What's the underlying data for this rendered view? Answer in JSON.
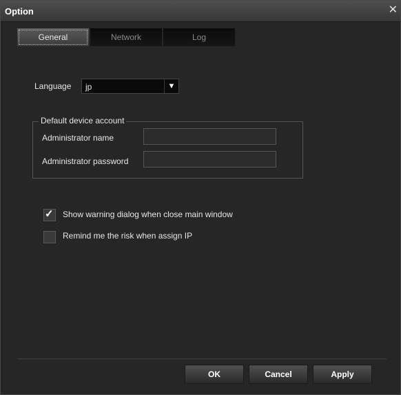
{
  "window": {
    "title": "Option",
    "close_symbol": "✕"
  },
  "tabs": [
    {
      "label": "General",
      "active": true
    },
    {
      "label": "Network",
      "active": false
    },
    {
      "label": "Log",
      "active": false
    }
  ],
  "general": {
    "language_label": "Language",
    "language_value": "jp",
    "account_group_title": "Default device account",
    "admin_name_label": "Administrator name",
    "admin_name_value": "",
    "admin_password_label": "Administrator password",
    "admin_password_value": "",
    "options": [
      {
        "label": "Show warning dialog when close main window",
        "checked": true
      },
      {
        "label": "Remind me the risk when assign IP",
        "checked": false
      }
    ]
  },
  "buttons": {
    "ok": "OK",
    "cancel": "Cancel",
    "apply": "Apply"
  },
  "icons": {
    "close": "close-icon",
    "dropdown": "chevron-down-icon",
    "check": "checkmark-icon"
  }
}
